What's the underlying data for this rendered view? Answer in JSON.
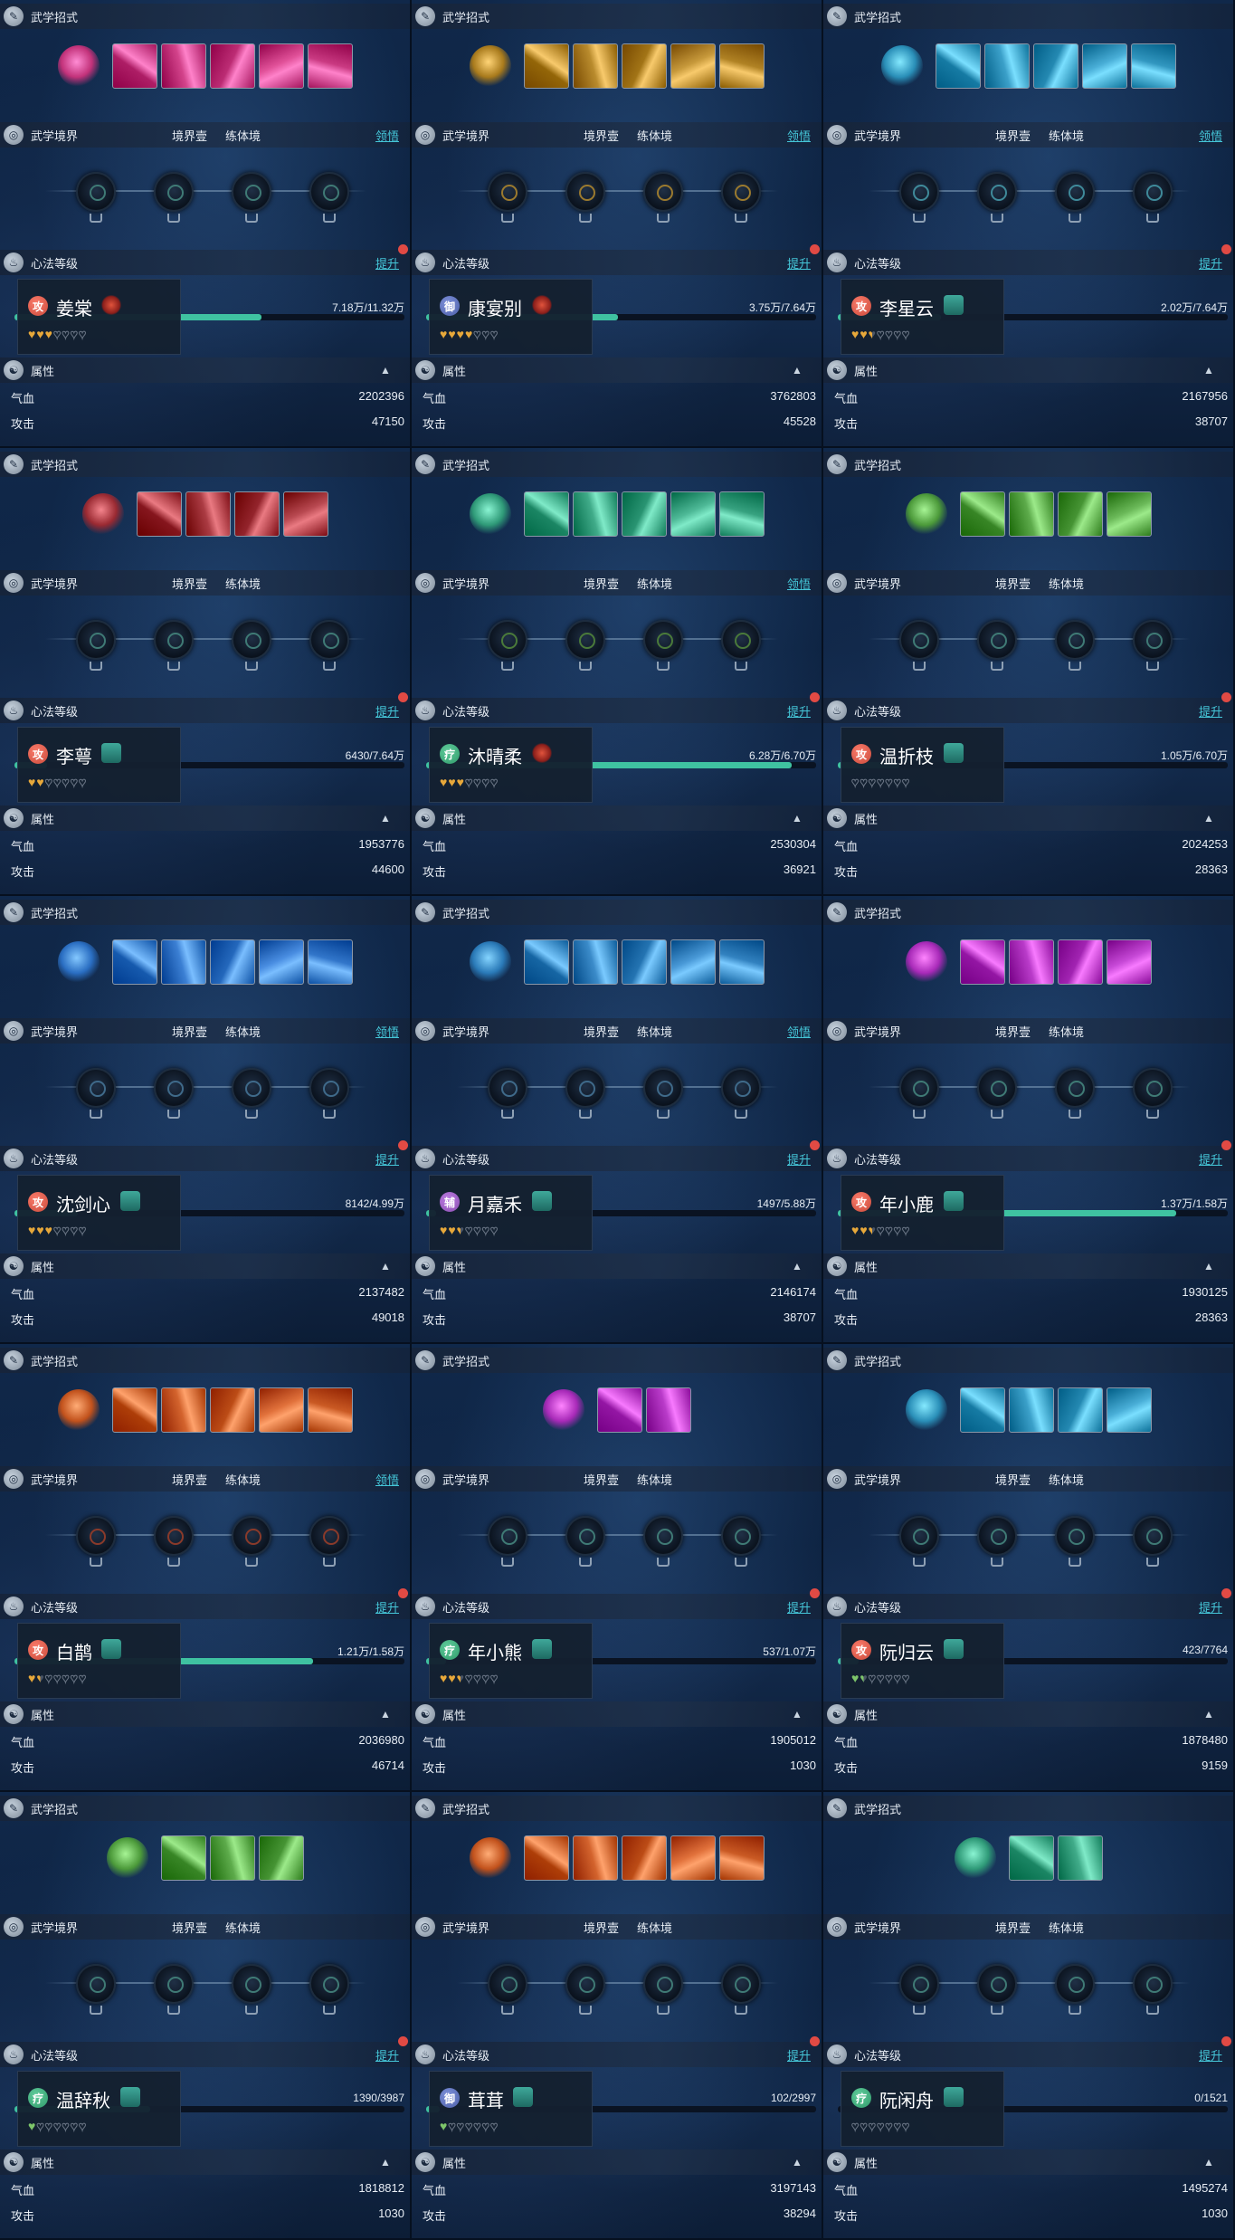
{
  "labels": {
    "skills_title": "武学招式",
    "realm_title": "武学境界",
    "realm_stage": "境界壹",
    "body_stage": "练体境",
    "comprehend": "领悟",
    "xinfa_title": "心法等级",
    "upgrade": "提升",
    "attr_title": "属性",
    "hp_label": "气血",
    "atk_label": "攻击"
  },
  "colors": {
    "progress_fill": "#3fc2a1",
    "link": "#45c6d8",
    "badge_red": "#e14a44",
    "heart_gold": "#e7a83a",
    "heart_green": "#7dc56a",
    "heart_empty": "#4a5566"
  },
  "characters": [
    {
      "name": "姜棠",
      "role_badge": "攻",
      "role_color": "#c94a3a",
      "faction_icon": "red-flower-icon",
      "has_comprehend": true,
      "progress_text": "7.18万/11.32万",
      "progress": 0.634,
      "hearts": {
        "count": 3,
        "color": "gold"
      },
      "hp": "2202396",
      "atk": "47150",
      "skill_theme": "#c2327a",
      "skill_count": 5,
      "node_color": "#3f7a75"
    },
    {
      "name": "康宴别",
      "role_badge": "御",
      "role_color": "#4c5fa8",
      "faction_icon": "red-flower-icon",
      "has_comprehend": true,
      "progress_text": "3.75万/7.64万",
      "progress": 0.491,
      "hearts": {
        "count": 4,
        "color": "gold"
      },
      "hp": "3762803",
      "atk": "45528",
      "skill_theme": "#a87a1c",
      "skill_count": 5,
      "node_color": "#9b7a2e"
    },
    {
      "name": "李星云",
      "role_badge": "攻",
      "role_color": "#c94a3a",
      "faction_icon": "teal-pavilion-icon",
      "has_comprehend": true,
      "progress_text": "2.02万/7.64万",
      "progress": 0.264,
      "hearts": {
        "count": 2.5,
        "color": "gold"
      },
      "hp": "2167956",
      "atk": "38707",
      "skill_theme": "#2a8fb8",
      "skill_count": 5,
      "node_color": "#3f8a9a"
    },
    {
      "name": "李萼",
      "role_badge": "攻",
      "role_color": "#c94a3a",
      "faction_icon": "teal-pavilion-icon",
      "has_comprehend": false,
      "progress_text": "6430/7.64万",
      "progress": 0.084,
      "hearts": {
        "count": 2,
        "color": "gold"
      },
      "hp": "1953776",
      "atk": "44600",
      "skill_theme": "#9a2a32",
      "skill_count": 4,
      "node_color": "#3f7a75"
    },
    {
      "name": "沐晴柔",
      "role_badge": "疗",
      "role_color": "#2f9a6a",
      "faction_icon": "red-flower-icon",
      "has_comprehend": true,
      "progress_text": "6.28万/6.70万",
      "progress": 0.937,
      "hearts": {
        "count": 3,
        "color": "gold"
      },
      "hp": "2530304",
      "atk": "36921",
      "skill_theme": "#2f9a78",
      "skill_count": 5,
      "node_color": "#4a7a3a"
    },
    {
      "name": "温折枝",
      "role_badge": "攻",
      "role_color": "#c94a3a",
      "faction_icon": "teal-pavilion-icon",
      "has_comprehend": false,
      "progress_text": "1.05万/6.70万",
      "progress": 0.157,
      "hearts": {
        "count": 0,
        "color": "gold"
      },
      "hp": "2024253",
      "atk": "28363",
      "skill_theme": "#4c9a3a",
      "skill_count": 4,
      "node_color": "#3f7a75"
    },
    {
      "name": "沈剑心",
      "role_badge": "攻",
      "role_color": "#c94a3a",
      "faction_icon": "teal-pavilion-icon",
      "has_comprehend": true,
      "progress_text": "8142/4.99万",
      "progress": 0.163,
      "hearts": {
        "count": 3,
        "color": "gold"
      },
      "hp": "2137482",
      "atk": "49018",
      "skill_theme": "#2a6ec2",
      "skill_count": 5,
      "node_color": "#3f6a8a"
    },
    {
      "name": "月嘉禾",
      "role_badge": "辅",
      "role_color": "#8a4cb0",
      "faction_icon": "teal-pavilion-icon",
      "has_comprehend": true,
      "progress_text": "1497/5.88万",
      "progress": 0.025,
      "hearts": {
        "count": 2.5,
        "color": "gold"
      },
      "hp": "2146174",
      "atk": "38707",
      "skill_theme": "#2a7ab8",
      "skill_count": 5,
      "node_color": "#3f6a8a"
    },
    {
      "name": "年小鹿",
      "role_badge": "攻",
      "role_color": "#c94a3a",
      "faction_icon": "teal-pavilion-icon",
      "has_comprehend": false,
      "progress_text": "1.37万/1.58万",
      "progress": 0.867,
      "hearts": {
        "count": 2.5,
        "color": "gold"
      },
      "hp": "1930125",
      "atk": "28363",
      "skill_theme": "#a82ab8",
      "skill_count": 4,
      "node_color": "#3f7a75"
    },
    {
      "name": "白鹊",
      "role_badge": "攻",
      "role_color": "#c94a3a",
      "faction_icon": "teal-pavilion-icon",
      "has_comprehend": true,
      "progress_text": "1.21万/1.58万",
      "progress": 0.766,
      "hearts": {
        "count": 1.5,
        "color": "gold"
      },
      "hp": "2036980",
      "atk": "46714",
      "skill_theme": "#c2521c",
      "skill_count": 5,
      "node_color": "#8a3a2a"
    },
    {
      "name": "年小熊",
      "role_badge": "疗",
      "role_color": "#2f9a6a",
      "faction_icon": "teal-pavilion-icon",
      "has_comprehend": false,
      "progress_text": "537/1.07万",
      "progress": 0.05,
      "hearts": {
        "count": 2.5,
        "color": "gold"
      },
      "hp": "1905012",
      "atk": "1030",
      "skill_theme": "#a82ab8",
      "skill_count": 2,
      "node_color": "#3f7a75"
    },
    {
      "name": "阮归云",
      "role_badge": "攻",
      "role_color": "#c94a3a",
      "faction_icon": "teal-pavilion-icon",
      "has_comprehend": false,
      "progress_text": "423/7764",
      "progress": 0.054,
      "hearts": {
        "count": 1.5,
        "color": "green"
      },
      "hp": "1878480",
      "atk": "9159",
      "skill_theme": "#2a8fb8",
      "skill_count": 4,
      "node_color": "#3f7a75"
    },
    {
      "name": "温辞秋",
      "role_badge": "疗",
      "role_color": "#2f9a6a",
      "faction_icon": "teal-pavilion-icon",
      "has_comprehend": false,
      "progress_text": "1390/3987",
      "progress": 0.349,
      "hearts": {
        "count": 1,
        "color": "green"
      },
      "hp": "1818812",
      "atk": "1030",
      "skill_theme": "#4c9a3a",
      "skill_count": 3,
      "node_color": "#3f7a75"
    },
    {
      "name": "茸茸",
      "role_badge": "御",
      "role_color": "#4c5fa8",
      "faction_icon": "teal-pavilion-icon",
      "has_comprehend": false,
      "progress_text": "102/2997",
      "progress": 0.034,
      "hearts": {
        "count": 1,
        "color": "green"
      },
      "hp": "3197143",
      "atk": "38294",
      "skill_theme": "#c2521c",
      "skill_count": 5,
      "node_color": "#3f7a75"
    },
    {
      "name": "阮闲舟",
      "role_badge": "疗",
      "role_color": "#2f9a6a",
      "faction_icon": "teal-pavilion-icon",
      "has_comprehend": false,
      "progress_text": "0/1521",
      "progress": 0,
      "hearts": {
        "count": 0,
        "color": "green"
      },
      "hp": "1495274",
      "atk": "1030",
      "skill_theme": "#2f9a78",
      "skill_count": 2,
      "node_color": "#3f7a75"
    }
  ]
}
